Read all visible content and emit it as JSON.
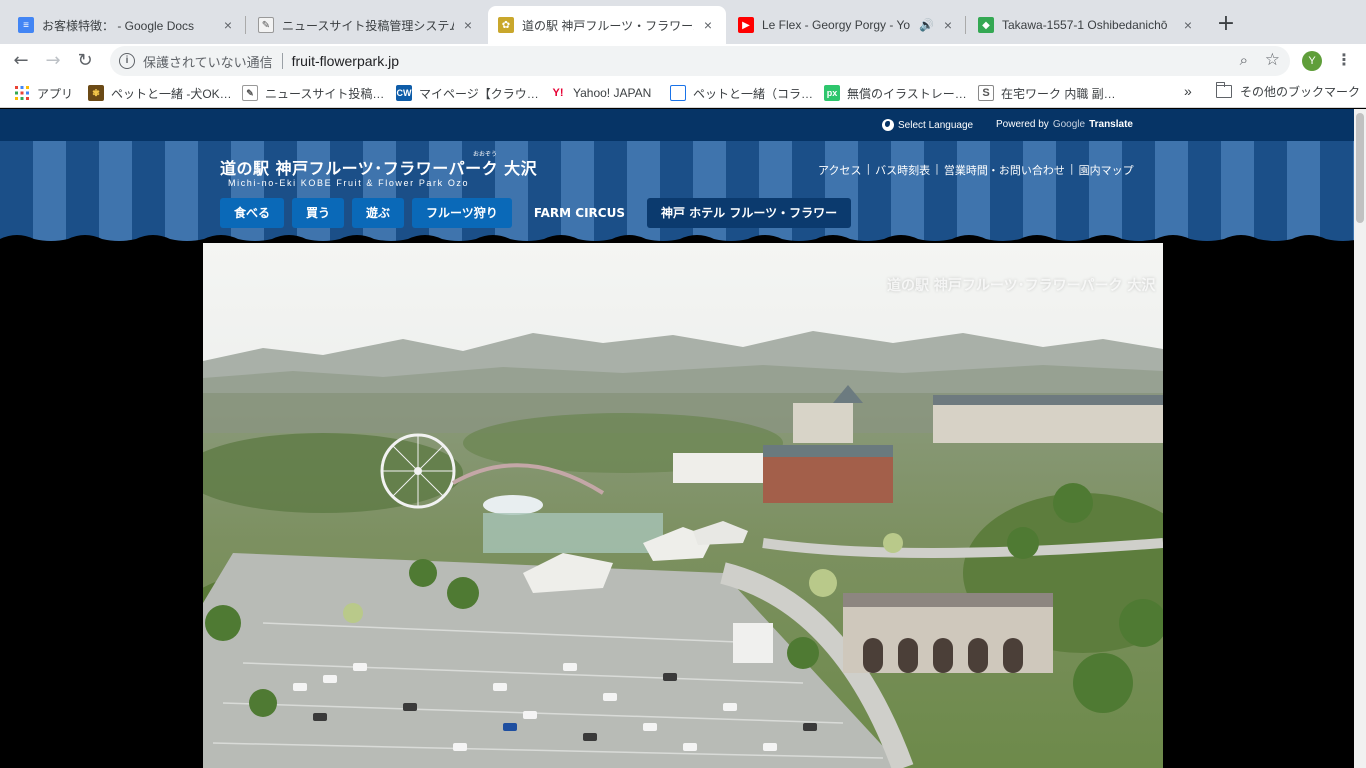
{
  "browser": {
    "tabs": [
      {
        "title": "お客様特徴： - Google Docs",
        "icon": "google-docs-icon",
        "active": false
      },
      {
        "title": "ニュースサイト投稿管理システム",
        "icon": "notepad-icon",
        "active": false
      },
      {
        "title": "道の駅 神戸フルーツ・フラワーパ",
        "icon": "park-favicon-icon",
        "active": true
      },
      {
        "title": "Le Flex - Georgy Porgy - Yo",
        "icon": "youtube-icon",
        "active": false,
        "audio": true
      },
      {
        "title": "Takawa-1557-1 Oshibedanichō",
        "icon": "google-maps-icon",
        "active": false
      }
    ],
    "new_tab": "+",
    "close_glyph": "×",
    "address": {
      "security_label": "保護されていない通信",
      "url": "fruit-flowerpark.jp"
    },
    "profile_initial": "Y",
    "bookmarks": [
      {
        "label": "アプリ",
        "icon": "apps-grid-icon"
      },
      {
        "label": "ペットと一緒 -犬OK…",
        "icon": "paw-icon"
      },
      {
        "label": "ニュースサイト投稿…",
        "icon": "notepad-icon"
      },
      {
        "label": "マイページ【クラウ…",
        "icon": "crowdworks-icon"
      },
      {
        "label": "Yahoo! JAPAN",
        "icon": "yahoo-icon"
      },
      {
        "label": "ペットと一緒（コラ…",
        "icon": "layout-icon"
      },
      {
        "label": "無償のイラストレー…",
        "icon": "pixabay-icon"
      },
      {
        "label": "在宅ワーク 内職 副…",
        "icon": "s-icon"
      }
    ],
    "bookmarks_more": "»",
    "other_bookmarks": "その他のブックマーク"
  },
  "site": {
    "topbar": {
      "select_language": "Select Language",
      "powered_by": "Powered by",
      "google": "Google",
      "translate": "Translate"
    },
    "logo": {
      "japanese": "道の駅 神戸フルーツ･フラワーパーク 大沢",
      "ruby": "おおぞう",
      "english": "Michi-no-Eki KOBE Fruit & Flower Park Ozo"
    },
    "utility_links": [
      "アクセス",
      "バス時刻表",
      "営業時間・お問い合わせ",
      "園内マップ"
    ],
    "utility_separator": "|",
    "global_nav": [
      "食べる",
      "買う",
      "遊ぶ",
      "フルーツ狩り",
      "FARM CIRCUS",
      "神戸 ホテル フルーツ・フラワー"
    ],
    "hero_watermark": "道の駅 神戸フルーツ･フラワーパーク 大沢"
  },
  "colors": {
    "topbar": "#063466",
    "stripe_dark": "#1b4f88",
    "stripe_light": "#3f74ad",
    "nav_button": "#0a69b8"
  }
}
